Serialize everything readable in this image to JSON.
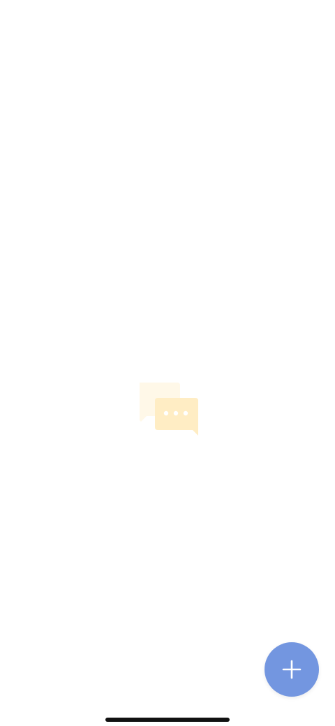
{
  "empty_state": {
    "icon": "chat-bubbles-icon",
    "back_bubble_color": "#FFF8E8",
    "front_bubble_color": "#FFEDC4",
    "dot_color": "#FFFFFF"
  },
  "fab": {
    "icon": "plus-icon",
    "color": "#7396E0",
    "icon_color": "#FFFFFF"
  },
  "home_indicator": {
    "color": "#111111"
  }
}
